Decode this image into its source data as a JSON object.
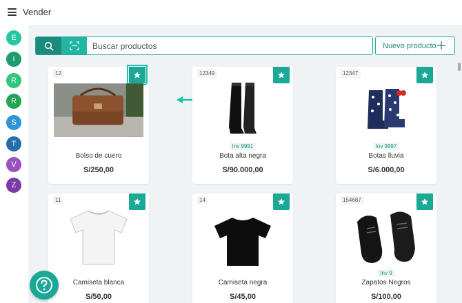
{
  "header": {
    "title": "Vender"
  },
  "sidebar": {
    "avatars": [
      {
        "letter": "E",
        "color": "#26c6a3"
      },
      {
        "letter": "I",
        "color": "#1d9c6e"
      },
      {
        "letter": "R",
        "color": "#2fc57c"
      },
      {
        "letter": "R",
        "color": "#22a455"
      },
      {
        "letter": "S",
        "color": "#2f95d6"
      },
      {
        "letter": "T",
        "color": "#236fa9"
      },
      {
        "letter": "V",
        "color": "#9a52c0"
      },
      {
        "letter": "Z",
        "color": "#7b3aa6"
      }
    ]
  },
  "search": {
    "placeholder": "Buscar productos"
  },
  "toolbar": {
    "new_product_label": "Nuevo producto"
  },
  "products": [
    {
      "code": "12",
      "name": "Bolso de cuero",
      "price": "S/250,00",
      "inventory": "",
      "image": "leather-bag"
    },
    {
      "code": "12349",
      "name": "Bota alta negra",
      "price": "S/90.000,00",
      "inventory": "Inv 9991",
      "image": "tall-black-boot"
    },
    {
      "code": "12347",
      "name": "Botas lluvia",
      "price": "S/6.000,00",
      "inventory": "Inv 9997",
      "image": "rain-boots"
    },
    {
      "code": "11",
      "name": "Camiseta blanca",
      "price": "S/50,00",
      "inventory": "",
      "image": "white-tshirt"
    },
    {
      "code": "14",
      "name": "Camiseta negra",
      "price": "S/45,00",
      "inventory": "",
      "image": "black-tshirt"
    },
    {
      "code": "154687",
      "name": "Zapatos Negros",
      "price": "S/100,00",
      "inventory": "Inv 9",
      "image": "black-shoes"
    }
  ],
  "colors": {
    "accent": "#1aa897",
    "accent_dark": "#1e8a7c",
    "background": "#f0f3f6"
  },
  "icons": {
    "search": "search-icon",
    "scan": "barcode-scan-icon",
    "favorite": "star-icon",
    "help": "question-icon",
    "menu": "hamburger-icon",
    "add": "plus-icon"
  }
}
